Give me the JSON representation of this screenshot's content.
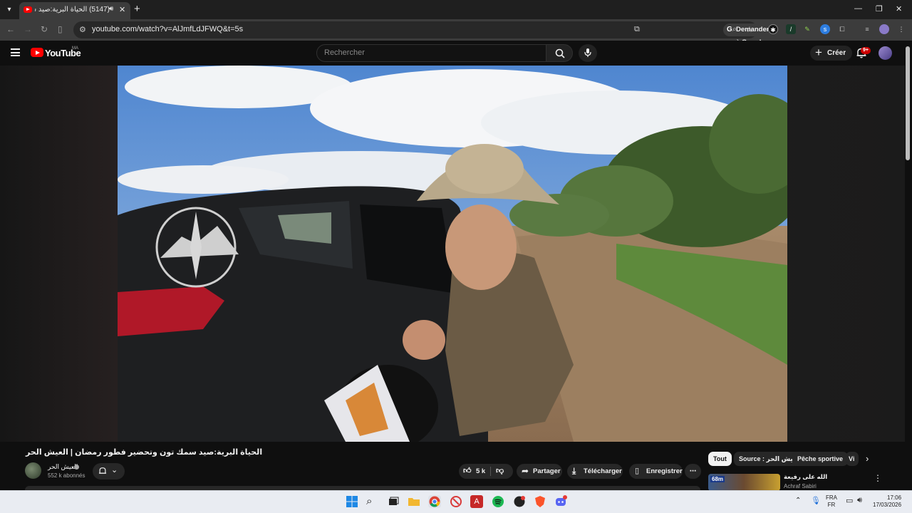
{
  "browser": {
    "tab_title": "(5147) الحياة البرية:صيد سمك",
    "address": "youtube.com/watch?v=AlJmfLdJFWQ&t=5s",
    "ask_google": "Demander à Google"
  },
  "youtube": {
    "logo_text": "YouTube",
    "region": "MA",
    "search_placeholder": "Rechercher",
    "create_label": "Créer",
    "notif_count": "9+"
  },
  "video": {
    "title": "الحياة البرية:صيد سمك تون وتحضير فطور رمضان | العيش الحر",
    "channel_name": "العيش الحر",
    "subscribers": "552 k abonnés",
    "like_count": "5 k",
    "share_label": "Partager",
    "download_label": "Télécharger",
    "save_label": "Enregistrer"
  },
  "chips": [
    "Tout",
    "Source : العيش الحر",
    "Pêche sportive",
    "Vi"
  ],
  "recommendation": {
    "title": "الله على رفيعة",
    "channel": "Achraf Sabiri",
    "thumb_badge": "68m"
  },
  "taskbar": {
    "lang_line1": "FRA",
    "lang_line2": "FR",
    "time": "17:06",
    "date": "17/03/2026"
  }
}
